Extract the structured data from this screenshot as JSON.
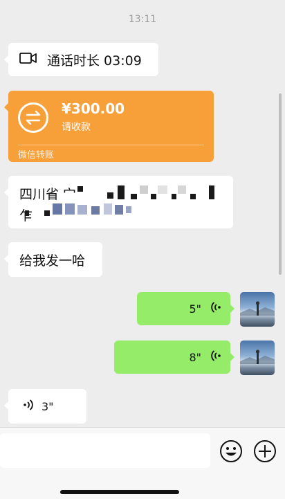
{
  "timestamp": "13:11",
  "call": {
    "icon": "video-camera-icon",
    "label": "通话时长 03:09"
  },
  "transfer": {
    "amount": "¥300.00",
    "status": "请收款",
    "footer": "微信转账",
    "color": "#f7a03a"
  },
  "address": {
    "line1": "四川省 宀",
    "line2": "乍"
  },
  "message2": {
    "text": "给我发一哈"
  },
  "voice_out_1": {
    "duration": "5\""
  },
  "voice_out_2": {
    "duration": "8\""
  },
  "voice_in_1": {
    "duration": "3\""
  },
  "colors": {
    "background": "#ededed",
    "bubble_out": "#95ec69",
    "bubble_in": "#ffffff",
    "transfer": "#f7a03a"
  },
  "bottom_bar": {
    "emoji_icon": "emoji-icon",
    "plus_icon": "plus-icon"
  }
}
